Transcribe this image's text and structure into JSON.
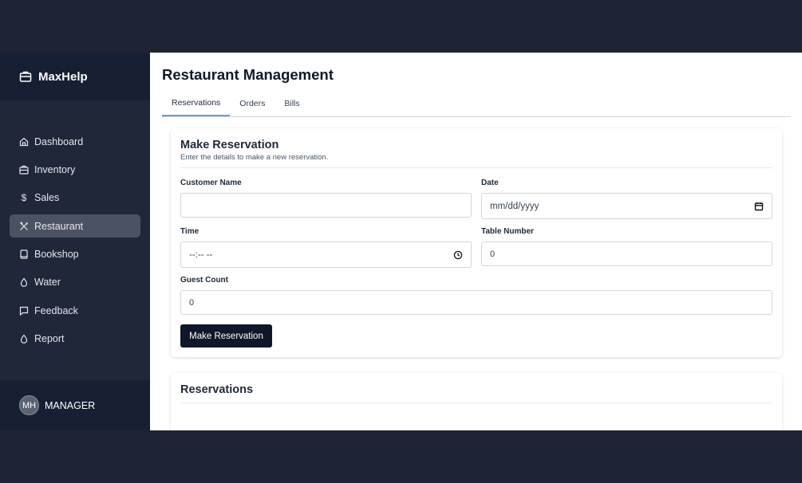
{
  "brand": {
    "name": "MaxHelp",
    "icon": "briefcase-icon"
  },
  "sidebar": {
    "items": [
      {
        "label": "Dashboard",
        "icon": "home-icon"
      },
      {
        "label": "Inventory",
        "icon": "briefcase-icon"
      },
      {
        "label": "Sales",
        "icon": "dollar-icon"
      },
      {
        "label": "Restaurant",
        "icon": "utensils-icon",
        "active": true
      },
      {
        "label": "Bookshop",
        "icon": "book-icon"
      },
      {
        "label": "Water",
        "icon": "droplet-icon"
      },
      {
        "label": "Feedback",
        "icon": "message-icon"
      },
      {
        "label": "Report",
        "icon": "droplet-icon"
      }
    ]
  },
  "user": {
    "initials": "MH",
    "role": "MANAGER"
  },
  "main": {
    "title": "Restaurant Management",
    "tabs": [
      {
        "label": "Reservations",
        "active": true
      },
      {
        "label": "Orders"
      },
      {
        "label": "Bills"
      }
    ],
    "form": {
      "title": "Make Reservation",
      "subtitle": "Enter the details to make a new reservation.",
      "fields": {
        "customer_name": {
          "label": "Customer Name",
          "value": ""
        },
        "date": {
          "label": "Date",
          "value": "mm/dd/yyyy"
        },
        "time": {
          "label": "Time",
          "value": "--:-- --"
        },
        "table_number": {
          "label": "Table Number",
          "value": "0"
        },
        "guest_count": {
          "label": "Guest Count",
          "value": "0"
        }
      },
      "submit_label": "Make Reservation"
    },
    "reservations": {
      "title": "Reservations"
    }
  },
  "colors": {
    "sidebar_bg": "#1f2739",
    "active_item": "#4b5363",
    "button_bg": "#0f172a",
    "tab_accent": "#6b9bd1"
  }
}
